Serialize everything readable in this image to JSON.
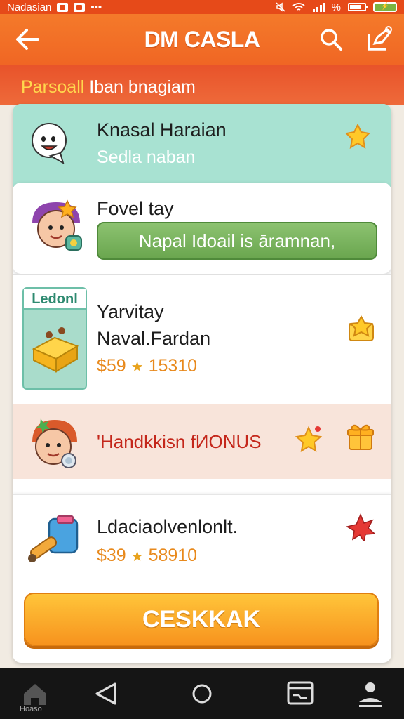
{
  "status_bar": {
    "carrier": "Nadasian",
    "dots": "•••",
    "battery_percent_label": "%"
  },
  "app_bar": {
    "title": "DM CASLA"
  },
  "subheader": {
    "accent_text": "Parsoall",
    "text": " Iban bnagiam"
  },
  "rows": [
    {
      "title": "Knasal Haraian",
      "subtitle": "Sedla naban",
      "background": "#a8e2d2"
    },
    {
      "title": "Fovel tay",
      "button_label": "Napal Idoail is āramnan,"
    },
    {
      "thumb_tag": "Ledonl",
      "title_line1": "Yarvitay",
      "title_line2": "Naval.Fardan",
      "price": "$59",
      "rating": "15310"
    },
    {
      "title": "'Handkkisn fИONUS",
      "background": "#f8e4da"
    },
    {
      "title": "Ldaciaolvenlonlt.",
      "price": "$39",
      "rating": "58910"
    }
  ],
  "cta": {
    "label": "CESKKAK"
  },
  "nav": {
    "home_label": "Hoaso"
  },
  "colors": {
    "app_bar": "#f06624",
    "subheader": "#e8532a",
    "accent_yellow": "#ffd84d",
    "price_orange": "#e8891c",
    "bonus_red": "#c4271b",
    "cta_orange": "#f7931e"
  }
}
